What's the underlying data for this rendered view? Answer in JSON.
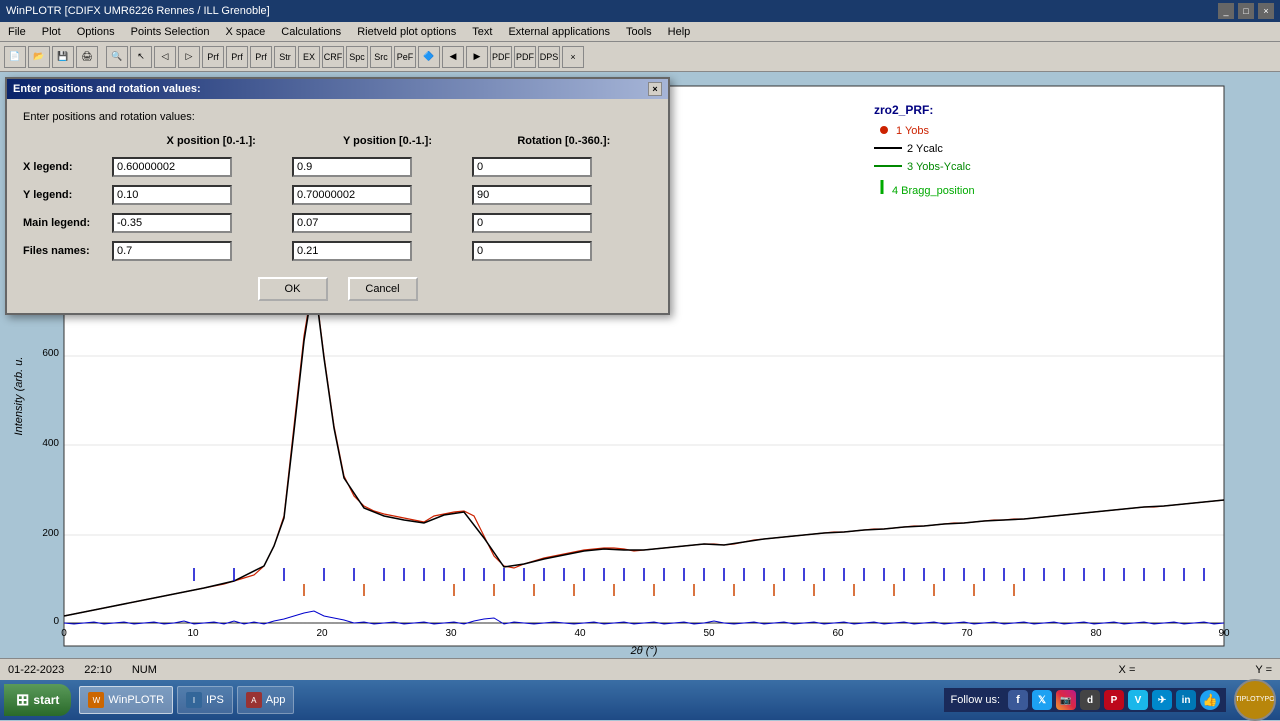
{
  "titlebar": {
    "title": "WinPLOTR [CDIFX UMR6226 Rennes / ILL Grenoble]",
    "controls": [
      "_",
      "□",
      "×"
    ]
  },
  "menubar": {
    "items": [
      "File",
      "Plot",
      "Options",
      "Points Selection",
      "X space",
      "Calculations",
      "Rietveld plot options",
      "Text",
      "External applications",
      "Tools",
      "Help"
    ]
  },
  "dialog": {
    "title": "Enter positions and rotation values:",
    "prompt": "Enter positions and rotation values:",
    "headers": {
      "x": "X position [0.-1.]:",
      "y": "Y position [0.-1.]:",
      "rot": "Rotation [0.-360.]:"
    },
    "rows": [
      {
        "label": "X legend:",
        "x_val": "0.60000002",
        "y_val": "0.9",
        "rot_val": "0"
      },
      {
        "label": "Y legend:",
        "x_val": "0.10",
        "y_val": "0.70000002",
        "rot_val": "90"
      },
      {
        "label": "Main legend:",
        "x_val": "-0.35",
        "y_val": "0.07",
        "rot_val": "0"
      },
      {
        "label": "Files names:",
        "x_val": "0.7",
        "y_val": "0.21",
        "rot_val": "0"
      }
    ],
    "buttons": {
      "ok": "OK",
      "cancel": "Cancel"
    }
  },
  "chart": {
    "title": "zro2_PRF:",
    "legend": [
      {
        "label": "1  Yobs",
        "color": "#cc0000",
        "type": "dot"
      },
      {
        "label": "2  Ycalc",
        "color": "#000000",
        "type": "line"
      },
      {
        "label": "3  Yobs-Ycalc",
        "color": "#008800",
        "type": "line"
      },
      {
        "label": "4  Bragg_position",
        "color": "#00cc00",
        "type": "bar"
      }
    ],
    "x_axis": {
      "label": "2θ (°)",
      "ticks": [
        "0",
        "10",
        "20",
        "30",
        "40",
        "50",
        "60",
        "70",
        "80",
        "90"
      ]
    },
    "y_axis": {
      "label": "Intensity (arb. u.",
      "ticks": [
        "0",
        "200",
        "400",
        "600"
      ]
    }
  },
  "statusbar": {
    "date": "01-22-2023",
    "time": "22:10",
    "num": "NUM",
    "x_label": "X =",
    "y_label": "Y ="
  },
  "taskbar": {
    "start_label": "start",
    "apps": [
      {
        "label": "WinPLOTR",
        "active": true
      },
      {
        "label": "IPS",
        "active": false
      },
      {
        "label": "App",
        "active": false
      }
    ],
    "follow_us": "Follow us:",
    "social": [
      "f",
      "𝕏",
      "📷",
      "d",
      "P",
      "V",
      "✈",
      "in",
      "👍"
    ]
  },
  "logo_text": "TIPLOTYPO"
}
